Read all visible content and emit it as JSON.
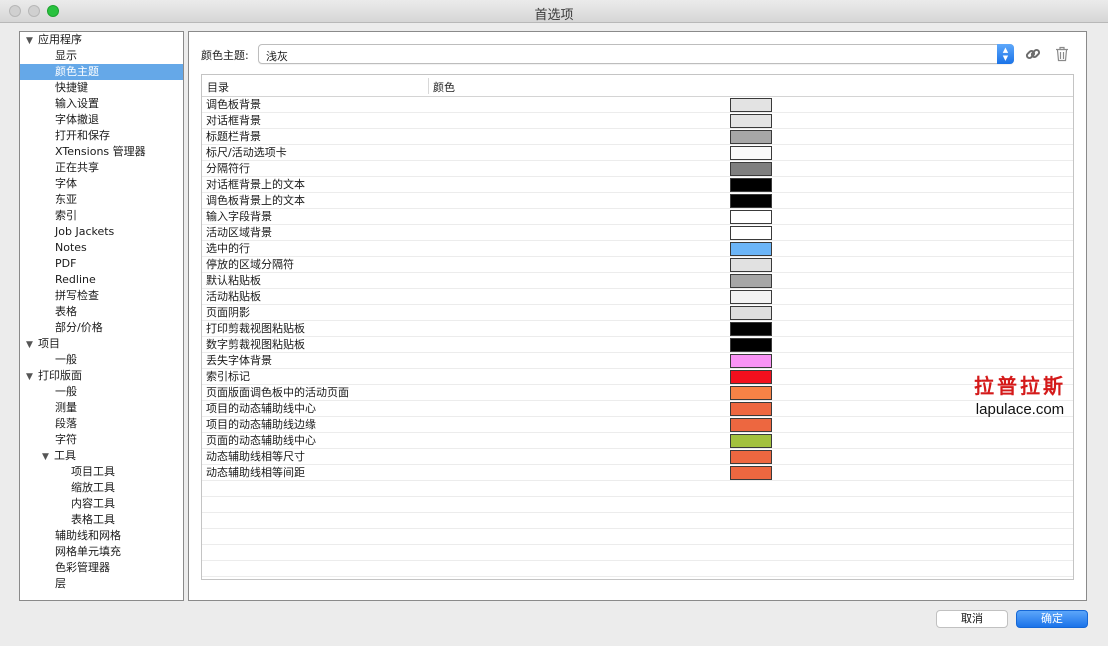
{
  "window": {
    "title": "首选项"
  },
  "sidebar": {
    "items": [
      {
        "label": "应用程序",
        "level": 0,
        "expanded": true
      },
      {
        "label": "显示",
        "level": 1
      },
      {
        "label": "颜色主题",
        "level": 1,
        "selected": true
      },
      {
        "label": "快捷键",
        "level": 1
      },
      {
        "label": "输入设置",
        "level": 1
      },
      {
        "label": "字体撤退",
        "level": 1
      },
      {
        "label": "打开和保存",
        "level": 1
      },
      {
        "label": "XTensions 管理器",
        "level": 1
      },
      {
        "label": "正在共享",
        "level": 1
      },
      {
        "label": "字体",
        "level": 1
      },
      {
        "label": "东亚",
        "level": 1
      },
      {
        "label": "索引",
        "level": 1
      },
      {
        "label": "Job Jackets",
        "level": 1
      },
      {
        "label": "Notes",
        "level": 1
      },
      {
        "label": "PDF",
        "level": 1
      },
      {
        "label": "Redline",
        "level": 1
      },
      {
        "label": "拼写检查",
        "level": 1
      },
      {
        "label": "表格",
        "level": 1
      },
      {
        "label": "部分/价格",
        "level": 1
      },
      {
        "label": "项目",
        "level": 0,
        "expanded": true
      },
      {
        "label": "一般",
        "level": 1
      },
      {
        "label": "打印版面",
        "level": 0,
        "expanded": true
      },
      {
        "label": "一般",
        "level": 1
      },
      {
        "label": "测量",
        "level": 1
      },
      {
        "label": "段落",
        "level": 1
      },
      {
        "label": "字符",
        "level": 1
      },
      {
        "label": "工具",
        "level": "1a",
        "expanded": true
      },
      {
        "label": "项目工具",
        "level": 2
      },
      {
        "label": "缩放工具",
        "level": 2
      },
      {
        "label": "内容工具",
        "level": 2
      },
      {
        "label": "表格工具",
        "level": 2
      },
      {
        "label": "辅助线和网格",
        "level": 1
      },
      {
        "label": "网格单元填充",
        "level": 1
      },
      {
        "label": "色彩管理器",
        "level": 1
      },
      {
        "label": "层",
        "level": 1
      }
    ]
  },
  "theme": {
    "label": "颜色主题:",
    "value": "浅灰"
  },
  "icons": {
    "link": "link-icon",
    "trash": "trash-icon",
    "expand": "disclosure-triangle-icon"
  },
  "table": {
    "headers": {
      "category": "目录",
      "color": "颜色"
    },
    "rows": [
      {
        "label": "调色板背景",
        "color": "#e3e3e3"
      },
      {
        "label": "对话框背景",
        "color": "#e4e4e4"
      },
      {
        "label": "标题栏背景",
        "color": "#a7a7a7"
      },
      {
        "label": "标尺/活动选项卡",
        "color": "#fafafa"
      },
      {
        "label": "分隔符行",
        "color": "#7f7f7f"
      },
      {
        "label": "对话框背景上的文本",
        "color": "#000000"
      },
      {
        "label": "调色板背景上的文本",
        "color": "#000000"
      },
      {
        "label": "输入字段背景",
        "color": "#ffffff"
      },
      {
        "label": "活动区域背景",
        "color": "#ffffff"
      },
      {
        "label": "选中的行",
        "color": "#6cb5f7"
      },
      {
        "label": "停放的区域分隔符",
        "color": "#e1e1e1"
      },
      {
        "label": "默认粘贴板",
        "color": "#a6a6a6"
      },
      {
        "label": "活动粘贴板",
        "color": "#f2f2f2"
      },
      {
        "label": "页面阴影",
        "color": "#dedede"
      },
      {
        "label": "打印剪裁视图粘贴板",
        "color": "#000000"
      },
      {
        "label": "数字剪裁视图粘贴板",
        "color": "#000000"
      },
      {
        "label": "丢失字体背景",
        "color": "#f993f5"
      },
      {
        "label": "索引标记",
        "color": "#f30f1d"
      },
      {
        "label": "页面版面调色板中的活动页面",
        "color": "#f78246"
      },
      {
        "label": "项目的动态辅助线中心",
        "color": "#ed6740"
      },
      {
        "label": "项目的动态辅助线边缘",
        "color": "#ed6740"
      },
      {
        "label": "页面的动态辅助线中心",
        "color": "#a3c13e"
      },
      {
        "label": "动态辅助线相等尺寸",
        "color": "#ed6740"
      },
      {
        "label": "动态辅助线相等间距",
        "color": "#ed6740"
      }
    ],
    "empty_rows": 6
  },
  "watermark": {
    "chinese": "拉普拉斯",
    "site": "lapulace.com"
  },
  "buttons": {
    "cancel": "取消",
    "ok": "确定"
  }
}
